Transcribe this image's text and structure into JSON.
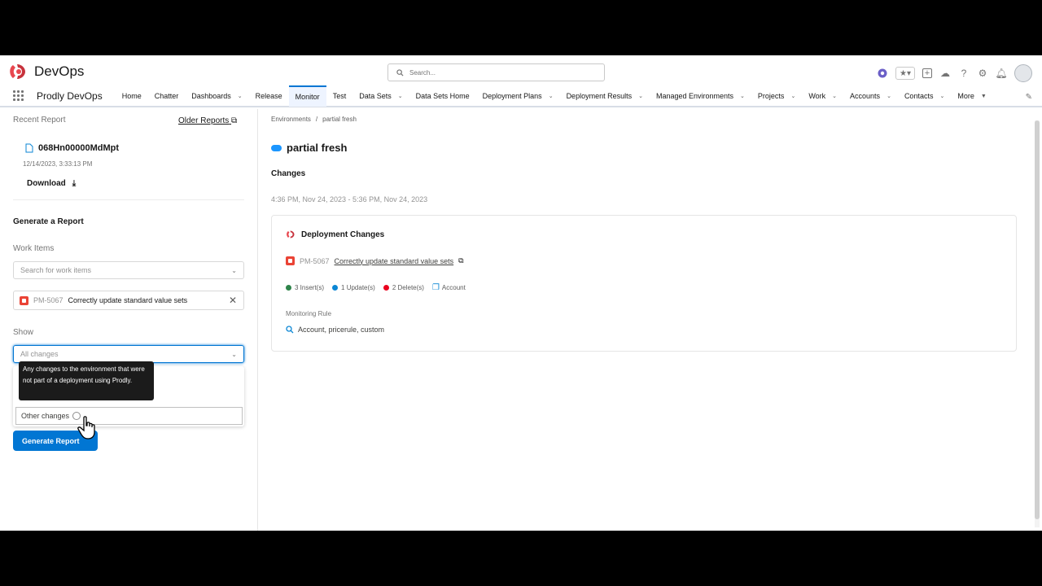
{
  "header": {
    "app_title": "DevOps",
    "search_placeholder": "Search..."
  },
  "nav": {
    "app_name": "Prodly DevOps",
    "items": [
      {
        "label": "Home",
        "dropdown": false
      },
      {
        "label": "Chatter",
        "dropdown": false
      },
      {
        "label": "Dashboards",
        "dropdown": true
      },
      {
        "label": "Release",
        "dropdown": false
      },
      {
        "label": "Monitor",
        "dropdown": false,
        "active": true
      },
      {
        "label": "Test",
        "dropdown": false
      },
      {
        "label": "Data Sets",
        "dropdown": true
      },
      {
        "label": "Data Sets Home",
        "dropdown": false
      },
      {
        "label": "Deployment Plans",
        "dropdown": true
      },
      {
        "label": "Deployment Results",
        "dropdown": true
      },
      {
        "label": "Managed Environments",
        "dropdown": true
      },
      {
        "label": "Projects",
        "dropdown": true
      },
      {
        "label": "Work",
        "dropdown": true
      },
      {
        "label": "Accounts",
        "dropdown": true
      },
      {
        "label": "Contacts",
        "dropdown": true
      },
      {
        "label": "More",
        "dropdown": true
      }
    ]
  },
  "left": {
    "recent_report_label": "Recent Report",
    "older_reports": "Older Reports",
    "file_name": "068Hn00000MdMpt",
    "file_date": "12/14/2023, 3:33:13 PM",
    "download": "Download",
    "generate_heading": "Generate a Report",
    "work_items_label": "Work Items",
    "work_items_placeholder": "Search for work items",
    "selected_item_id": "PM-5067",
    "selected_item_title": "Correctly update standard value sets",
    "show_label": "Show",
    "show_value": "All changes",
    "tooltip": "Any changes to the environment that were not part of a deployment using Prodly.",
    "option_other": "Other changes",
    "generate_button": "Generate Report"
  },
  "right": {
    "breadcrumb": [
      "Environments",
      "partial fresh"
    ],
    "env_title": "partial fresh",
    "changes_heading": "Changes",
    "range": "4:36 PM, Nov 24, 2023 - 5:36 PM, Nov 24, 2023",
    "card_title": "Deployment Changes",
    "item_id": "PM-5067",
    "item_title": "Correctly update standard value sets",
    "inserts": "3 Insert(s)",
    "updates": "1 Update(s)",
    "deletes": "2 Delete(s)",
    "object": "Account",
    "monitoring_rule_label": "Monitoring Rule",
    "monitoring_rule": "Account, pricerule, custom"
  },
  "colors": {
    "brand_blue": "#0176d3",
    "insert_green": "#2e844a",
    "update_blue": "#0b86d4",
    "delete_red": "#ea001e"
  }
}
